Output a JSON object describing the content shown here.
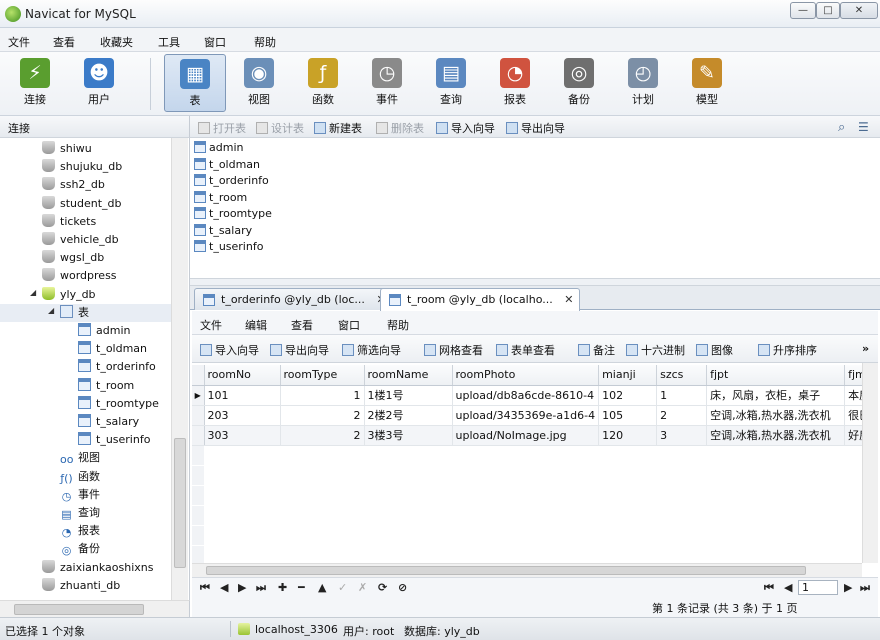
{
  "window": {
    "title": "Navicat for MySQL",
    "controls": {
      "minimize": "—",
      "maximize": "□",
      "close": "✕"
    }
  },
  "menu": [
    "文件",
    "查看",
    "收藏夹",
    "工具",
    "窗口",
    "帮助"
  ],
  "toolbar": [
    {
      "label": "连接",
      "icon": "connection-icon",
      "color": "#5a9e2f",
      "glyph": "⚡"
    },
    {
      "label": "用户",
      "icon": "user-icon",
      "color": "#3b7bc8",
      "glyph": "☻"
    },
    {
      "label": "表",
      "icon": "table-icon",
      "color": "#4a84c4",
      "glyph": "▦"
    },
    {
      "label": "视图",
      "icon": "view-icon",
      "color": "#6b8fb8",
      "glyph": "◉"
    },
    {
      "label": "函数",
      "icon": "function-icon",
      "color": "#c9a227",
      "glyph": "ƒ"
    },
    {
      "label": "事件",
      "icon": "event-icon",
      "color": "#8a8a8a",
      "glyph": "◷"
    },
    {
      "label": "查询",
      "icon": "query-icon",
      "color": "#5b88c0",
      "glyph": "▤"
    },
    {
      "label": "报表",
      "icon": "report-icon",
      "color": "#d0533f",
      "glyph": "◔"
    },
    {
      "label": "备份",
      "icon": "backup-icon",
      "color": "#6f6f6f",
      "glyph": "◎"
    },
    {
      "label": "计划",
      "icon": "schedule-icon",
      "color": "#7c8fa6",
      "glyph": "◴"
    },
    {
      "label": "模型",
      "icon": "model-icon",
      "color": "#c58b2a",
      "glyph": "✎"
    }
  ],
  "conn_head": "连接",
  "tree": {
    "databases_top": [
      "shiwu",
      "shujuku_db",
      "ssh2_db",
      "student_db",
      "tickets",
      "vehicle_db",
      "wgsl_db",
      "wordpress"
    ],
    "open_db": "yly_db",
    "tables_node": "表",
    "tables": [
      "admin",
      "t_oldman",
      "t_orderinfo",
      "t_room",
      "t_roomtype",
      "t_salary",
      "t_userinfo"
    ],
    "other_nodes": [
      {
        "label": "视图",
        "glyph": "oo"
      },
      {
        "label": "函数",
        "glyph": "ƒ()"
      },
      {
        "label": "事件",
        "glyph": "◷"
      },
      {
        "label": "查询",
        "glyph": "▤"
      },
      {
        "label": "报表",
        "glyph": "◔"
      },
      {
        "label": "备份",
        "glyph": "◎"
      }
    ],
    "databases_bottom": [
      "zaixiankaoshixns",
      "zhuanti_db"
    ]
  },
  "objbar": [
    {
      "label": "打开表",
      "disabled": true
    },
    {
      "label": "设计表",
      "disabled": true
    },
    {
      "label": "新建表",
      "disabled": false
    },
    {
      "label": "删除表",
      "disabled": true
    },
    {
      "label": "导入向导",
      "disabled": false
    },
    {
      "label": "导出向导",
      "disabled": false
    }
  ],
  "objects": [
    "admin",
    "t_oldman",
    "t_orderinfo",
    "t_room",
    "t_roomtype",
    "t_salary",
    "t_userinfo"
  ],
  "tabs": [
    {
      "label": "t_orderinfo @yly_db (loc...",
      "close": "✕",
      "active": false
    },
    {
      "label": "t_room @yly_db (localho...",
      "close": "✕",
      "active": true
    }
  ],
  "inner_menu": [
    "文件",
    "编辑",
    "查看",
    "窗口",
    "帮助"
  ],
  "inner_tools": [
    "导入向导",
    "导出向导",
    "筛选向导",
    "网格查看",
    "表单查看",
    "备注",
    "十六进制",
    "图像",
    "升序排序"
  ],
  "grid": {
    "columns": [
      "roomNo",
      "roomType",
      "roomName",
      "roomPhoto",
      "mianji",
      "szcs",
      "fjpt",
      "fjms"
    ],
    "rows": [
      [
        "101",
        "1",
        "1楼1号",
        "upload/db8a6cde-8610-4",
        "102",
        "1",
        "床，风扇，衣柜，桌子",
        "本房"
      ],
      [
        "203",
        "2",
        "2楼2号",
        "upload/3435369e-a1d6-4",
        "105",
        "2",
        "空调,冰箱,热水器,洗衣机",
        "很巴"
      ],
      [
        "303",
        "2",
        "3楼3号",
        "upload/NoImage.jpg",
        "120",
        "3",
        "空调,冰箱,热水器,洗衣机",
        "好房"
      ]
    ]
  },
  "nav": {
    "first": "⏮",
    "prev": "◀",
    "next": "▶",
    "last": "⏭",
    "add": "✚",
    "delete": "━",
    "up": "▲",
    "apply": "✓",
    "discard": "✗",
    "refresh": "⟳",
    "stop": "⊘",
    "page": "1"
  },
  "record_info": "第 1 条记录 (共 3 条) 于 1 页",
  "status": {
    "selection": "已选择 1 个对象",
    "connection": "localhost_3306",
    "user": "用户: root",
    "database": "数据库: yly_db"
  }
}
